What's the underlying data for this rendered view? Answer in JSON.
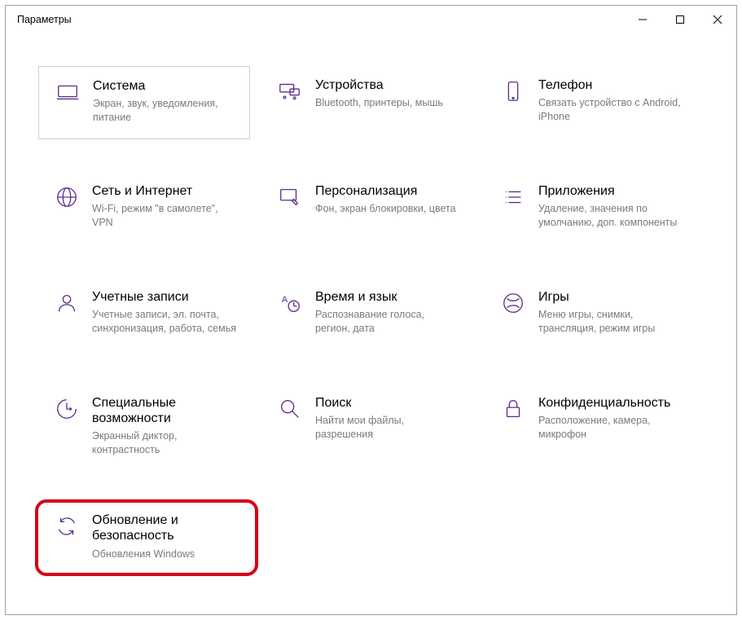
{
  "window": {
    "title": "Параметры"
  },
  "tiles": {
    "system": {
      "title": "Система",
      "desc": "Экран, звук, уведомления, питание"
    },
    "devices": {
      "title": "Устройства",
      "desc": "Bluetooth, принтеры, мышь"
    },
    "phone": {
      "title": "Телефон",
      "desc": "Связать устройство с Android, iPhone"
    },
    "network": {
      "title": "Сеть и Интернет",
      "desc": "Wi-Fi, режим \"в самолете\", VPN"
    },
    "personal": {
      "title": "Персонализация",
      "desc": "Фон, экран блокировки, цвета"
    },
    "apps": {
      "title": "Приложения",
      "desc": "Удаление, значения по умолчанию, доп. компоненты"
    },
    "accounts": {
      "title": "Учетные записи",
      "desc": "Учетные записи, эл. почта, синхронизация, работа, семья"
    },
    "time": {
      "title": "Время и язык",
      "desc": "Распознавание голоса, регион, дата"
    },
    "gaming": {
      "title": "Игры",
      "desc": "Меню игры, снимки, трансляция, режим игры"
    },
    "ease": {
      "title": "Специальные возможности",
      "desc": "Экранный диктор, контрастность"
    },
    "search": {
      "title": "Поиск",
      "desc": "Найти мои файлы, разрешения"
    },
    "privacy": {
      "title": "Конфиденциальность",
      "desc": "Расположение, камера, микрофон"
    },
    "update": {
      "title": "Обновление и безопасность",
      "desc": "Обновления Windows"
    }
  }
}
